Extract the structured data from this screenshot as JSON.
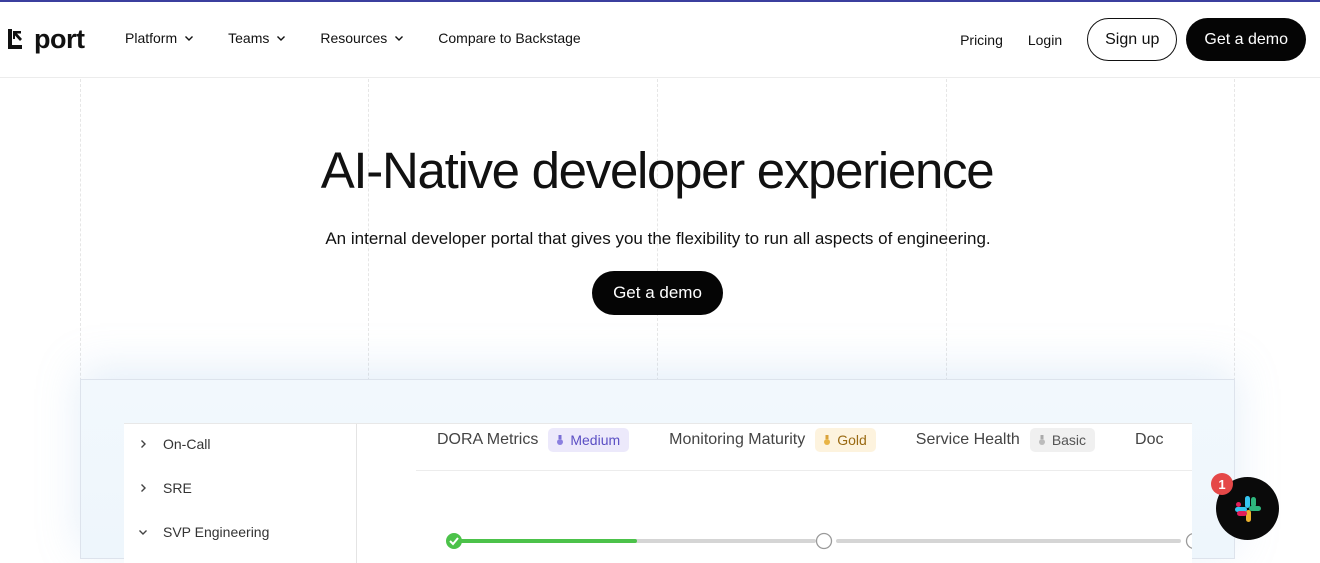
{
  "brand": {
    "name": "port"
  },
  "nav": {
    "items": [
      {
        "label": "Platform"
      },
      {
        "label": "Teams"
      },
      {
        "label": "Resources"
      },
      {
        "label": "Compare to Backstage"
      }
    ],
    "pricing": "Pricing",
    "login": "Login",
    "signup": "Sign up",
    "demo": "Get a demo"
  },
  "hero": {
    "title": "AI-Native developer experience",
    "subtitle": "An internal developer portal that gives you the flexibility to run all aspects of engineering.",
    "cta": "Get a demo"
  },
  "preview": {
    "sidebar": [
      {
        "label": "On-Call",
        "expanded": false
      },
      {
        "label": "SRE",
        "expanded": false
      },
      {
        "label": "SVP Engineering",
        "expanded": true
      }
    ],
    "metrics": [
      {
        "label": "DORA Metrics",
        "level": "Medium"
      },
      {
        "label": "Monitoring Maturity",
        "level": "Gold"
      },
      {
        "label": "Service Health",
        "level": "Basic"
      },
      {
        "label": "Doc",
        "level": ""
      }
    ],
    "progress_fraction": 0.5
  },
  "slack": {
    "unread": "1"
  },
  "colors": {
    "accent_line": "#3b3f9e",
    "progress_green": "#4cc24a",
    "badge_red": "#e54848"
  }
}
